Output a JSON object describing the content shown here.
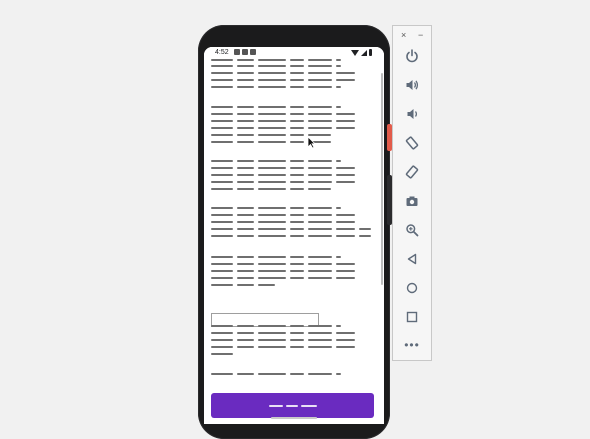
{
  "status_bar": {
    "time": "4:52"
  },
  "toolbar": {
    "close_label": "×",
    "minimize_label": "−",
    "more_label": "•••",
    "buttons": [
      {
        "icon": "power-icon"
      },
      {
        "icon": "volume-up-icon"
      },
      {
        "icon": "volume-down-icon"
      },
      {
        "icon": "rotate-left-icon"
      },
      {
        "icon": "rotate-right-icon"
      },
      {
        "icon": "camera-icon"
      },
      {
        "icon": "zoom-icon"
      },
      {
        "icon": "back-icon"
      },
      {
        "icon": "home-icon"
      },
      {
        "icon": "overview-icon"
      },
      {
        "icon": "more-icon"
      }
    ]
  },
  "app": {
    "input_value": "",
    "primary_button_label": "",
    "colors": {
      "primary": "#6a2bc0",
      "phone_frame": "#1b1b1c",
      "text_placeholder": "#6f6f6f"
    }
  }
}
